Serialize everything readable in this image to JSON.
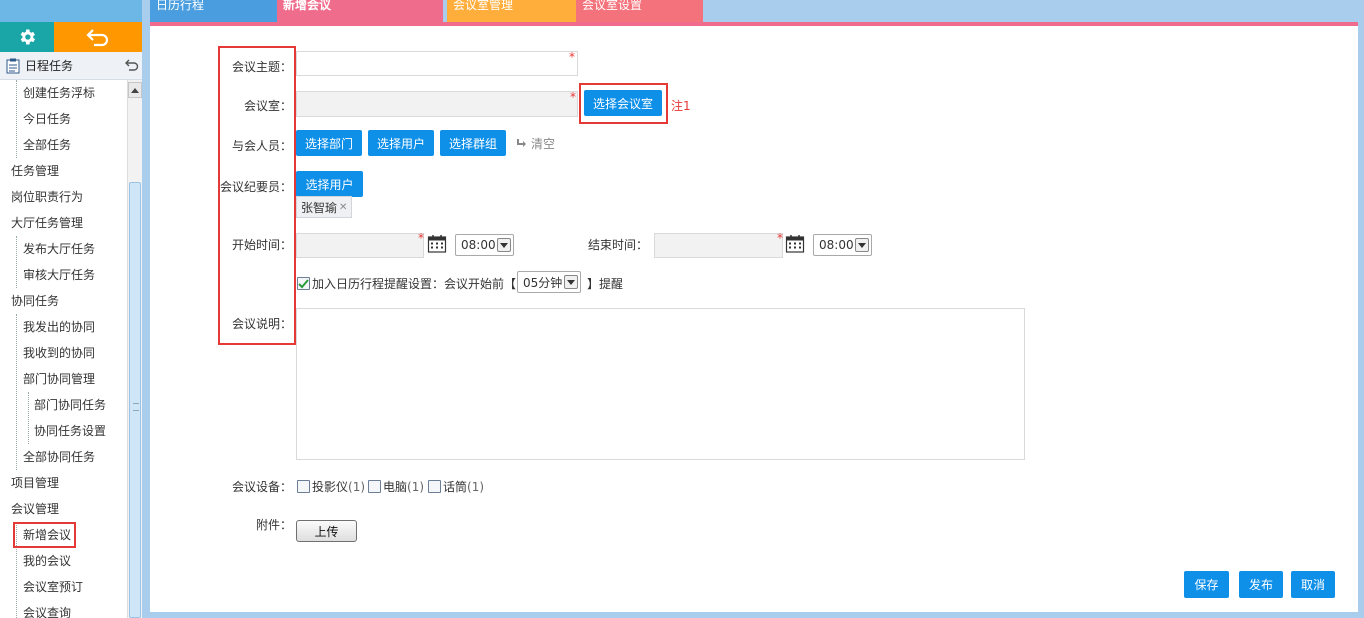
{
  "sidebar": {
    "header_title": "日程任务",
    "items": [
      {
        "label": "创建任务浮标",
        "level": 1
      },
      {
        "label": "今日任务",
        "level": 1
      },
      {
        "label": "全部任务",
        "level": 1
      },
      {
        "label": "任务管理",
        "level": 0
      },
      {
        "label": "岗位职责行为",
        "level": 0
      },
      {
        "label": "大厅任务管理",
        "level": 0
      },
      {
        "label": "发布大厅任务",
        "level": 1
      },
      {
        "label": "审核大厅任务",
        "level": 1
      },
      {
        "label": "协同任务",
        "level": 0
      },
      {
        "label": "我发出的协同",
        "level": 1
      },
      {
        "label": "我收到的协同",
        "level": 1
      },
      {
        "label": "部门协同管理",
        "level": 1
      },
      {
        "label": "部门协同任务",
        "level": 2
      },
      {
        "label": "协同任务设置",
        "level": 2
      },
      {
        "label": "全部协同任务",
        "level": 1
      },
      {
        "label": "项目管理",
        "level": 0
      },
      {
        "label": "会议管理",
        "level": 0
      },
      {
        "label": "新增会议",
        "level": 1,
        "selected": true
      },
      {
        "label": "我的会议",
        "level": 1
      },
      {
        "label": "会议室预订",
        "level": 1
      },
      {
        "label": "会议查询",
        "level": 1
      }
    ]
  },
  "tabs": [
    {
      "label": "日历行程",
      "color": "#4a9ee0"
    },
    {
      "label": "新增会议",
      "color": "#f06c8c",
      "active": true
    },
    {
      "label": "会议室管理",
      "color": "#ffad3b"
    },
    {
      "label": "会议室设置",
      "color": "#f4727b"
    }
  ],
  "form": {
    "subject": {
      "label": "会议主题：",
      "value": ""
    },
    "room": {
      "label": "会议室：",
      "value": "",
      "select_button": "选择会议室",
      "note": "注1"
    },
    "attendees": {
      "label": "与会人员：",
      "btn_dept": "选择部门",
      "btn_user": "选择用户",
      "btn_group": "选择群组",
      "clear": "清空"
    },
    "recorder": {
      "label": "会议纪要员：",
      "btn_user": "选择用户",
      "tag": "张智瑜"
    },
    "start": {
      "label": "开始时间：",
      "date": "",
      "time": "08:00"
    },
    "end": {
      "label": "结束时间：",
      "date": "",
      "time": "08:00"
    },
    "reminder": {
      "checked": true,
      "text_before": "加入日历行程提醒设置：会议开始前【",
      "option": "05分钟",
      "text_after": "】提醒"
    },
    "description": {
      "label": "会议说明：",
      "value": ""
    },
    "equipment": {
      "label": "会议设备：",
      "items": [
        {
          "name": "投影仪",
          "count": "(1)",
          "checked": false
        },
        {
          "name": "电脑",
          "count": "(1)",
          "checked": false
        },
        {
          "name": "话筒",
          "count": "(1)",
          "checked": false
        }
      ]
    },
    "attachment": {
      "label": "附件：",
      "upload": "上传"
    }
  },
  "actions": {
    "save": "保存",
    "publish": "发布",
    "cancel": "取消"
  },
  "colors": {
    "primary_button": "#0e8fe8",
    "highlight": "#e53935",
    "required": "#e53935",
    "settings_tile": "#1aa6a6",
    "back_tile": "#ff9800"
  }
}
